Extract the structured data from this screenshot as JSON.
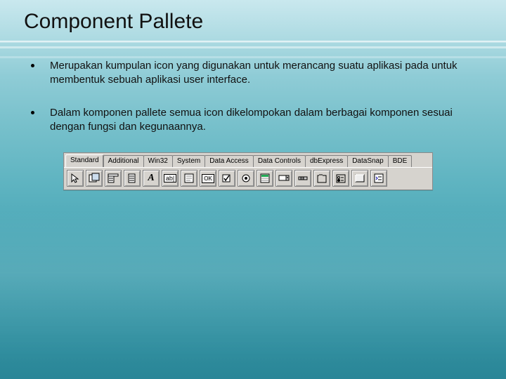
{
  "title": "Component Pallete",
  "bullets": [
    "Merupakan  kumpulan icon yang digunakan untuk merancang suatu aplikasi pada  untuk membentuk sebuah aplikasi user interface.",
    "Dalam komponen pallete semua icon dikelompokan dalam berbagai komponen sesuai dengan fungsi dan kegunaannya."
  ],
  "palette": {
    "tabs": [
      "Standard",
      "Additional",
      "Win32",
      "System",
      "Data Access",
      "Data Controls",
      "dbExpress",
      "DataSnap",
      "BDE"
    ],
    "active_tab": "Standard",
    "tools": [
      {
        "name": "pointer-icon",
        "letter": ""
      },
      {
        "name": "frames-icon",
        "letter": ""
      },
      {
        "name": "mainmenu-icon",
        "letter": ""
      },
      {
        "name": "popupmenu-icon",
        "letter": ""
      },
      {
        "name": "label-icon",
        "letter": "A"
      },
      {
        "name": "edit-icon",
        "letter": "ab"
      },
      {
        "name": "memo-icon",
        "letter": ""
      },
      {
        "name": "button-icon",
        "letter": "OK"
      },
      {
        "name": "checkbox-icon",
        "letter": ""
      },
      {
        "name": "radiobutton-icon",
        "letter": ""
      },
      {
        "name": "listbox-icon",
        "letter": ""
      },
      {
        "name": "combobox-icon",
        "letter": ""
      },
      {
        "name": "scrollbar-icon",
        "letter": ""
      },
      {
        "name": "groupbox-icon",
        "letter": ""
      },
      {
        "name": "radiogroup-icon",
        "letter": ""
      },
      {
        "name": "panel-icon",
        "letter": ""
      },
      {
        "name": "actionlist-icon",
        "letter": ""
      }
    ]
  }
}
